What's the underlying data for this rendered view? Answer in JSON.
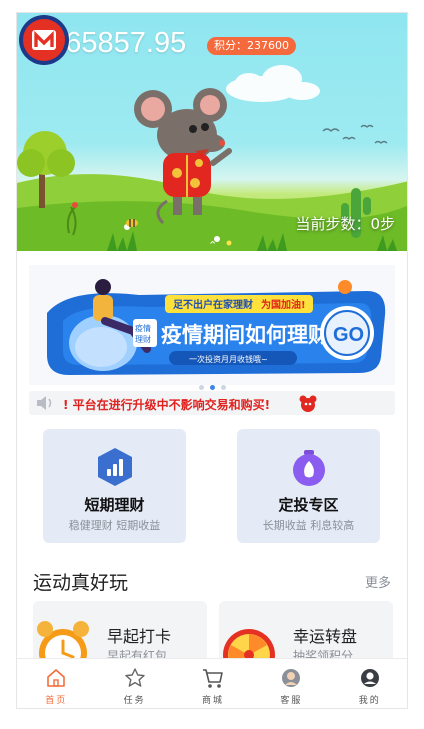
{
  "hero": {
    "balance": "2365857.95",
    "points_label": "积分：237600",
    "steps_label": "当前步数：0步"
  },
  "banner": {
    "tag_line": "足不出户在家理财",
    "tag_highlight": "为国加油!",
    "side_tag_line1": "理财",
    "side_tag_line2": "疫情",
    "headline": "疫情期间如何理财",
    "subline": "一次投资月月收钱哦~",
    "go_label": "GO"
  },
  "notice": {
    "text": "! 平台在进行升级中不影响交易和购买!"
  },
  "cards": [
    {
      "title": "短期理财",
      "subtitle": "稳健理财 短期收益",
      "icon": "chart-bars-icon"
    },
    {
      "title": "定投专区",
      "subtitle": "长期收益 利息较高",
      "icon": "money-bag-icon"
    }
  ],
  "section": {
    "title": "运动真好玩",
    "more": "更多"
  },
  "activities": [
    {
      "title": "早起打卡",
      "subtitle": "早起有红包",
      "icon": "alarm-clock-icon"
    },
    {
      "title": "幸运转盘",
      "subtitle": "抽奖领积分",
      "icon": "lucky-wheel-icon"
    }
  ],
  "tabs": [
    {
      "label": "首页",
      "icon": "home-icon",
      "active": true
    },
    {
      "label": "任务",
      "icon": "star-icon",
      "active": false
    },
    {
      "label": "商城",
      "icon": "cart-icon",
      "active": false
    },
    {
      "label": "客服",
      "icon": "service-icon",
      "active": false
    },
    {
      "label": "我的",
      "icon": "user-icon",
      "active": false
    }
  ],
  "colors": {
    "accent": "#f36d3a",
    "card_bg": "#e4ebf6",
    "notice_red": "#e0211d",
    "banner_blue": "#1f6ed8"
  }
}
